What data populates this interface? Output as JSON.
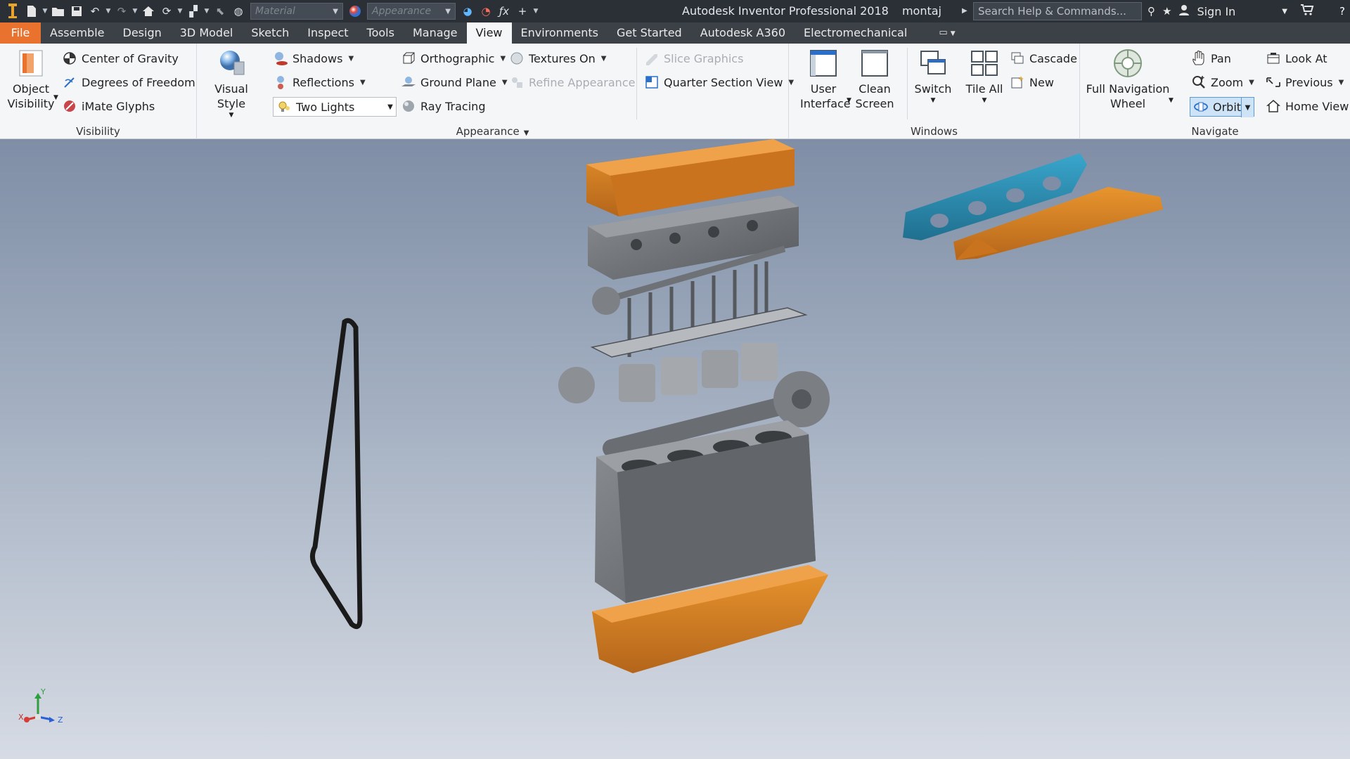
{
  "titlebar": {
    "app_title": "Autodesk Inventor Professional 2018",
    "document": "montaj",
    "material_placeholder": "Material",
    "appearance_placeholder": "Appearance",
    "search_placeholder": "Search Help & Commands...",
    "sign_in": "Sign In"
  },
  "tabs": {
    "file": "File",
    "items": [
      "Assemble",
      "Design",
      "3D Model",
      "Sketch",
      "Inspect",
      "Tools",
      "Manage",
      "View",
      "Environments",
      "Get Started",
      "Autodesk A360",
      "Electromechanical"
    ],
    "active": "View"
  },
  "visibility": {
    "label": "Visibility",
    "object_visibility": [
      "Object",
      "Visibility"
    ],
    "center_of_gravity": "Center of Gravity",
    "degrees_of_freedom": "Degrees of Freedom",
    "imate_glyphs": "iMate Glyphs"
  },
  "appearance": {
    "label": "Appearance",
    "visual_style": "Visual Style",
    "shadows": "Shadows",
    "reflections": "Reflections",
    "lighting": "Two Lights",
    "orthographic": "Orthographic",
    "ground_plane": "Ground Plane",
    "ray_tracing": "Ray Tracing",
    "textures_on": "Textures On",
    "refine_appearance": "Refine Appearance",
    "slice_graphics": "Slice Graphics",
    "quarter_section_view": "Quarter Section View"
  },
  "windows": {
    "label": "Windows",
    "user_interface": [
      "User",
      "Interface"
    ],
    "clean_screen": [
      "Clean",
      "Screen"
    ],
    "switch": "Switch",
    "tile_all": "Tile All",
    "cascade": "Cascade",
    "new": "New"
  },
  "navigate": {
    "label": "Navigate",
    "full_navigation_wheel": [
      "Full Navigation",
      "Wheel"
    ],
    "pan": "Pan",
    "zoom": "Zoom",
    "orbit": "Orbit",
    "look_at": "Look At",
    "previous": "Previous",
    "home_view": "Home View"
  },
  "triad": {
    "x": "X",
    "y": "Y",
    "z": "Z"
  },
  "colors": {
    "accent_orange": "#e8722e",
    "part_orange": "#d9821f",
    "part_blue": "#2d8fb5",
    "part_gray": "#7b7e82"
  }
}
